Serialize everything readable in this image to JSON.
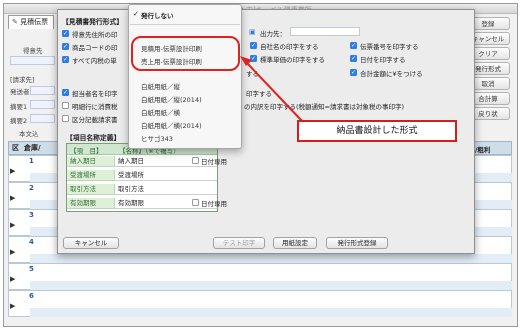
{
  "window": {
    "title": "[見積伝票入力]キーベル建事業所"
  },
  "main_tab": {
    "label": "見積伝票"
  },
  "background_labels": {
    "tokuisaki": "得意先",
    "seikyusaki": "[請求先]",
    "hakkosaki": "発送者",
    "tekiyo1": "摘要1",
    "tekiyo2": "摘要2",
    "honbun": "本文込"
  },
  "right_buttons": [
    "登録",
    "キャンセル",
    "クリア",
    "発行形式",
    "取消",
    "合計算",
    "戻り状"
  ],
  "grid": {
    "header_cols": [
      "区",
      "倉庫/"
    ],
    "right_header": "売価/粗利",
    "row_numbers": [
      "1",
      "2",
      "3",
      "4",
      "5",
      "6"
    ]
  },
  "dialog": {
    "format_label": "【見積書発行形式】",
    "options_left": [
      {
        "label": "得意先住所の印",
        "checked": true
      },
      {
        "label": "商品コードの印",
        "checked": true
      },
      {
        "label": "すべて内税の単",
        "checked": true
      },
      {
        "label": "担当者名を印字",
        "checked": true
      },
      {
        "label": "明細行に消費税",
        "checked": false
      },
      {
        "label": "区分記載請求書",
        "checked": false
      }
    ],
    "output_label": "出力先：",
    "options_mid": [
      {
        "label": "自社名の印字をする",
        "checked": true
      },
      {
        "label": "標準単価の印字をする",
        "checked": true
      }
    ],
    "options_right": [
      {
        "label": "伝票番号を印字する",
        "checked": true
      },
      {
        "label": "日付を印字する",
        "checked": true
      },
      {
        "label": "合計金額に¥をつける",
        "checked": true
      }
    ],
    "mid_text_1": "する",
    "mid_text_2": "印字する",
    "long_text": "の内訳を印字する(税額通知=請求書は対象税の事印字)",
    "name_def_label": "【項目名称定義】",
    "name_table": {
      "header_item": "【項　目】",
      "header_name": "【名称】（※で複写）",
      "rows": [
        {
          "label": "納入期日",
          "value": "納入期日",
          "has_check": true,
          "check_label": "日付専用"
        },
        {
          "label": "受渡場所",
          "value": "受渡場所",
          "has_check": false,
          "check_label": ""
        },
        {
          "label": "取引方法",
          "value": "取引方法",
          "has_check": false,
          "check_label": ""
        },
        {
          "label": "有効期限",
          "value": "有効期限",
          "has_check": true,
          "check_label": "日付専用"
        }
      ]
    },
    "buttons": {
      "cancel": "キャンセル",
      "test_print": "テスト印字",
      "paper_settings": "用紙設定",
      "register_format": "発行形式登録"
    }
  },
  "dropdown": {
    "selected": "発行しない",
    "items": [
      "見積用-伝票設計印刷",
      "売上用-伝票設計印刷",
      "白紙用紙／縦",
      "白紙用紙／縦(2014)",
      "白紙用紙／横",
      "白紙用紙／横(2014)",
      "ヒサゴ343"
    ]
  },
  "annotation": {
    "callout_text": "納品書設計した形式"
  },
  "colors": {
    "accent_blue": "#2f7ee8",
    "highlight_red": "#e12020",
    "grid_header": "#cfdde9",
    "name_label_green": "#dff0d8"
  }
}
